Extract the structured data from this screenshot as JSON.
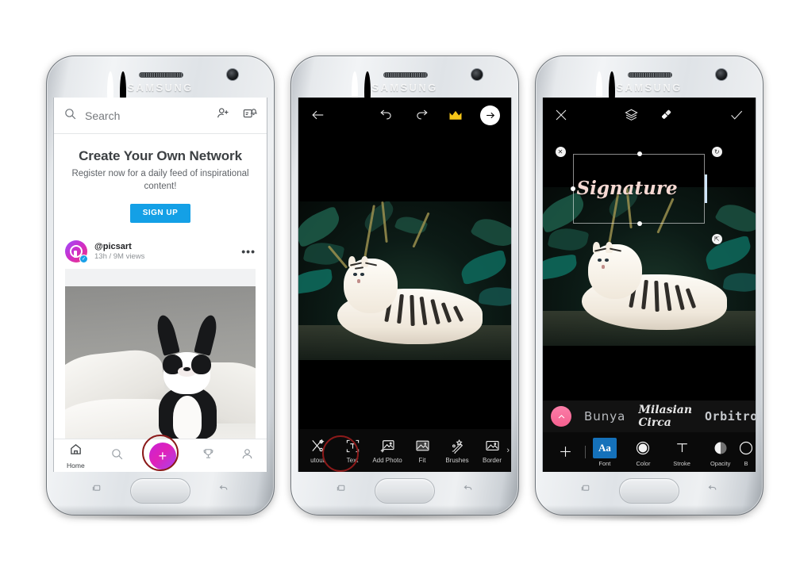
{
  "device": {
    "brand": "SAMSUNG"
  },
  "phone1": {
    "search": {
      "placeholder": "Search",
      "icon": "search-icon"
    },
    "header_icons": [
      {
        "name": "add-friend-icon"
      },
      {
        "name": "notifications-icon"
      }
    ],
    "promo": {
      "title": "Create Your Own Network",
      "subtitle": "Register now for a daily feed of inspirational content!",
      "cta": "SIGN UP"
    },
    "post": {
      "username": "@picsart",
      "meta": "13h / 9M views",
      "more": "•••",
      "image_alt": "boston-terrier-dog-on-white-bed"
    },
    "tabs": [
      {
        "label": "Home",
        "icon": "home-icon",
        "active": true
      },
      {
        "label": "",
        "icon": "search-icon",
        "active": false
      },
      {
        "label": "",
        "icon": "plus-icon",
        "active": false,
        "highlighted": true
      },
      {
        "label": "",
        "icon": "trophy-icon",
        "active": false
      },
      {
        "label": "",
        "icon": "profile-icon",
        "active": false
      }
    ],
    "annotation": "red-circle-around-plus-button"
  },
  "phone2": {
    "top_icons": [
      {
        "name": "back-arrow-icon"
      },
      {
        "name": "undo-icon"
      },
      {
        "name": "redo-icon"
      },
      {
        "name": "premium-crown-icon"
      },
      {
        "name": "next-arrow-button"
      }
    ],
    "canvas_alt": "white-tiger-lying-in-dark-jungle",
    "tools": [
      {
        "label": "utout",
        "icon": "cutout-icon"
      },
      {
        "label": "Text",
        "icon": "text-tool-icon",
        "highlighted": true
      },
      {
        "label": "Add Photo",
        "icon": "add-photo-icon"
      },
      {
        "label": "Fit",
        "icon": "fit-icon"
      },
      {
        "label": "Brushes",
        "icon": "brushes-icon"
      },
      {
        "label": "Border",
        "icon": "border-icon"
      }
    ],
    "annotation": "red-circle-around-text-tool"
  },
  "phone3": {
    "top_icons": [
      {
        "name": "close-icon"
      },
      {
        "name": "layers-icon"
      },
      {
        "name": "eraser-icon"
      },
      {
        "name": "confirm-check-icon"
      }
    ],
    "text_layer": {
      "value": "Signature",
      "handles": [
        {
          "name": "delete-handle",
          "glyph": "✕"
        },
        {
          "name": "rotate-handle",
          "glyph": "↻"
        },
        {
          "name": "resize-handle",
          "glyph": "⤡"
        }
      ]
    },
    "fonts": [
      {
        "name": "Bunya"
      },
      {
        "name": "Milasian Circa"
      },
      {
        "name": "Orbitron"
      },
      {
        "name": "("
      }
    ],
    "collapse_icon": "chevron-up-icon",
    "tools": [
      {
        "label": "",
        "icon": "add-text-icon"
      },
      {
        "label": "Font",
        "icon": "font-icon",
        "selected": true
      },
      {
        "label": "Color",
        "icon": "color-icon"
      },
      {
        "label": "Stroke",
        "icon": "stroke-icon"
      },
      {
        "label": "Opacity",
        "icon": "opacity-icon"
      },
      {
        "label": "B",
        "icon": "blend-icon"
      }
    ]
  },
  "colors": {
    "accent_blue": "#14a0e6",
    "plus_gradient_start": "#c722d8",
    "plus_gradient_end": "#a743f2",
    "crown_gold": "#f5c518",
    "annotation_red": "#8b1a1a",
    "font_selected_blue": "#1571ba",
    "collapse_pink": "#f5608f"
  }
}
